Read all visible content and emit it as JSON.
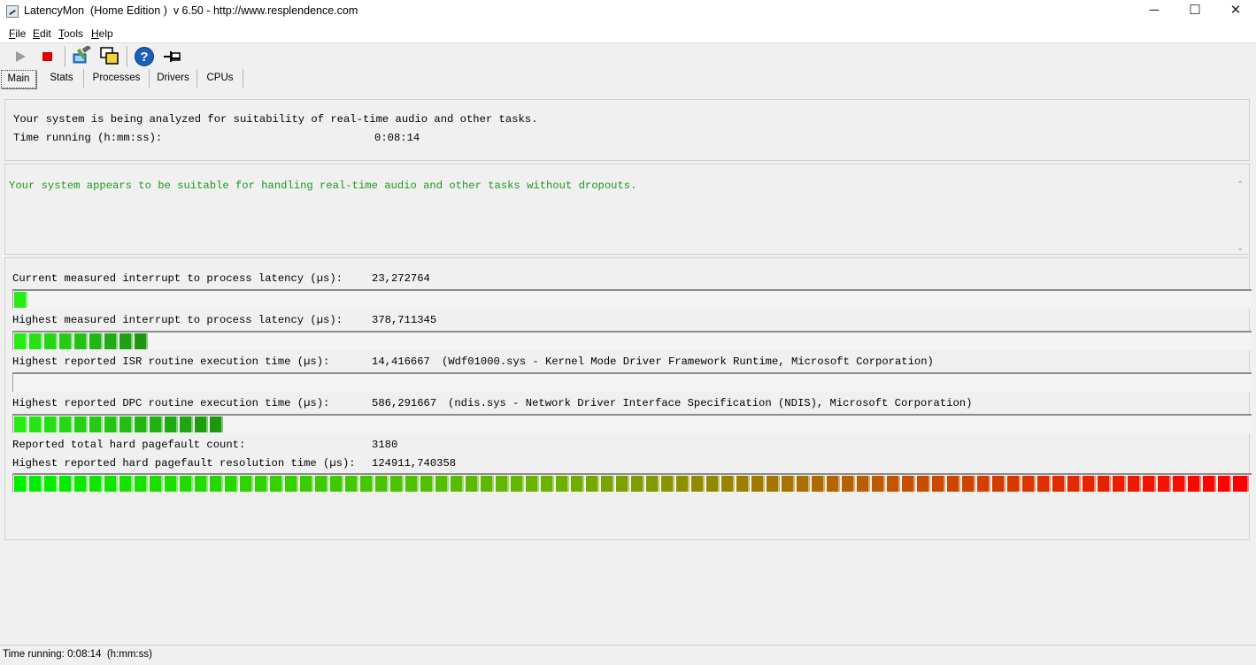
{
  "window": {
    "title": "LatencyMon  (Home Edition )  v 6.50 - http://www.resplendence.com",
    "minimize": "─",
    "maximize": "☐",
    "close": "✕"
  },
  "menu": [
    "File",
    "Edit",
    "Tools",
    "Help"
  ],
  "toolbar": {
    "icons": [
      "play-icon",
      "stop-icon",
      "hammer-monitor-icon",
      "window-overlay-icon",
      "help-icon",
      "pin-icon"
    ],
    "colors": {
      "stop": "#e00000",
      "help": "#1c5fb8"
    }
  },
  "tabs": [
    "Main",
    "Stats",
    "Processes",
    "Drivers",
    "CPUs"
  ],
  "summary": {
    "analyzing": "Your system is being analyzed for suitability of real-time audio and other tasks.",
    "time_label": "Time running (h:mm:ss):",
    "time_value": "0:08:14"
  },
  "verdict": {
    "text": "Your system appears to be suitable for handling real-time audio and other tasks without dropouts.",
    "color": "#1e9820"
  },
  "metrics": [
    {
      "label": "Current measured interrupt to process latency (µs):",
      "value": "23,272764",
      "detail": "",
      "bar_fraction": 0.01
    },
    {
      "label": "Highest measured interrupt to process latency (µs):",
      "value": "378,711345",
      "detail": "",
      "bar_fraction": 0.107
    },
    {
      "label": "Highest reported ISR routine execution time (µs):",
      "value": "14,416667",
      "detail": "(Wdf01000.sys - Kernel Mode Driver Framework Runtime, Microsoft Corporation)",
      "bar_fraction": 0.0
    },
    {
      "label": "Highest reported DPC routine execution time (µs):",
      "value": "586,291667",
      "detail": "(ndis.sys - Network Driver Interface Specification (NDIS), Microsoft Corporation)",
      "bar_fraction": 0.168
    },
    {
      "label": "Reported total hard pagefault count:",
      "value": "3180",
      "detail": ""
    },
    {
      "label": "Highest reported hard pagefault resolution time (µs):",
      "value": "124911,740358",
      "detail": "",
      "bar_fraction": 1.0
    }
  ],
  "status": {
    "text": "Time running: 0:08:14  (h:mm:ss)"
  }
}
